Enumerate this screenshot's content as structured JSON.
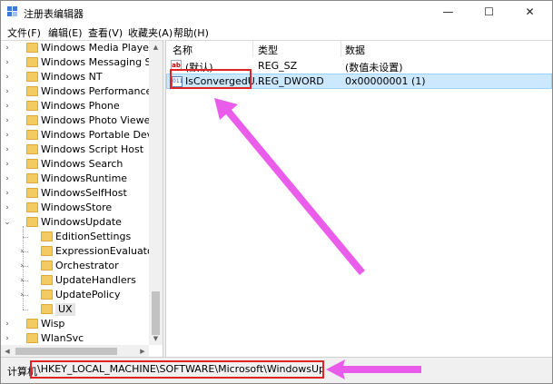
{
  "window": {
    "title": "注册表编辑器",
    "min_glyph": "—",
    "max_glyph": "☐",
    "close_glyph": "✕"
  },
  "menu": [
    "文件(F)",
    "编辑(E)",
    "查看(V)",
    "收藏夹(A)",
    "帮助(H)"
  ],
  "tree": {
    "items": [
      {
        "label": "Windows Media Player NSS",
        "expander": "›",
        "level": 1
      },
      {
        "label": "Windows Messaging Subsystem",
        "expander": "›",
        "level": 1
      },
      {
        "label": "Windows NT",
        "expander": "›",
        "level": 1
      },
      {
        "label": "Windows Performance Toolkit",
        "expander": "›",
        "level": 1
      },
      {
        "label": "Windows Phone",
        "expander": "›",
        "level": 1
      },
      {
        "label": "Windows Photo Viewer",
        "expander": "›",
        "level": 1
      },
      {
        "label": "Windows Portable Devices",
        "expander": "›",
        "level": 1
      },
      {
        "label": "Windows Script Host",
        "expander": "›",
        "level": 1
      },
      {
        "label": "Windows Search",
        "expander": "›",
        "level": 1
      },
      {
        "label": "WindowsRuntime",
        "expander": "›",
        "level": 1
      },
      {
        "label": "WindowsSelfHost",
        "expander": "›",
        "level": 1
      },
      {
        "label": "WindowsStore",
        "expander": "›",
        "level": 1
      },
      {
        "label": "WindowsUpdate",
        "expander": "⌄",
        "level": 1
      },
      {
        "label": "EditionSettings",
        "expander": "",
        "level": 2
      },
      {
        "label": "ExpressionEvaluators",
        "expander": "›",
        "level": 2
      },
      {
        "label": "Orchestrator",
        "expander": "›",
        "level": 2
      },
      {
        "label": "UpdateHandlers",
        "expander": "›",
        "level": 2
      },
      {
        "label": "UpdatePolicy",
        "expander": "›",
        "level": 2
      },
      {
        "label": "UX",
        "expander": "",
        "level": 2,
        "selected": true
      },
      {
        "label": "Wisp",
        "expander": "›",
        "level": 1
      },
      {
        "label": "WlanSvc",
        "expander": "›",
        "level": 1
      }
    ]
  },
  "list": {
    "columns": [
      "名称",
      "类型",
      "数据"
    ],
    "rows": [
      {
        "icon": "string-value-icon",
        "icon_text": "ab",
        "name": "(默认)",
        "type": "REG_SZ",
        "data": "(数值未设置)"
      },
      {
        "icon": "dword-value-icon",
        "icon_text": "011",
        "name": "IsConvergedU...",
        "type": "REG_DWORD",
        "data": "0x00000001 (1)",
        "selected": true
      }
    ]
  },
  "status": {
    "label": "计算机",
    "path": "\\HKEY_LOCAL_MACHINE\\SOFTWARE\\Microsoft\\WindowsUpdate\\UX"
  },
  "colors": {
    "annotation_arrow": "#e84fe8",
    "annotation_box": "#e02424",
    "selection": "#cce8ff"
  }
}
